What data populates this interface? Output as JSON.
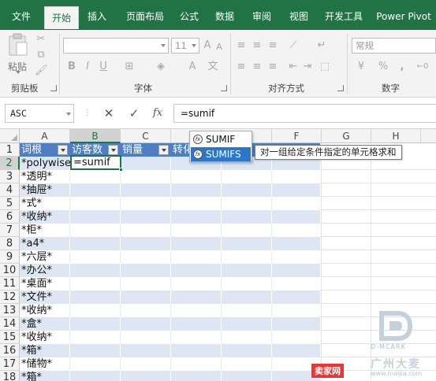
{
  "ribbon": {
    "tabs": [
      {
        "label": "文件",
        "active": false
      },
      {
        "label": "开始",
        "active": true
      },
      {
        "label": "插入",
        "active": false
      },
      {
        "label": "页面布局",
        "active": false
      },
      {
        "label": "公式",
        "active": false
      },
      {
        "label": "数据",
        "active": false
      },
      {
        "label": "审阅",
        "active": false
      },
      {
        "label": "视图",
        "active": false
      },
      {
        "label": "开发工具",
        "active": false
      },
      {
        "label": "Power Pivot",
        "active": false
      }
    ],
    "clipboard": {
      "paste_label": "粘贴",
      "group_label": "剪贴板"
    },
    "font": {
      "font_size": "11",
      "group_label": "字体"
    },
    "alignment": {
      "group_label": "对齐方式"
    },
    "number": {
      "format": "常规",
      "group_label": "数字"
    }
  },
  "formula_bar": {
    "name_box": "ASC",
    "cancel_icon": "✕",
    "enter_icon": "✓",
    "fx_icon": "fx",
    "formula": "=sumif"
  },
  "grid": {
    "columns": [
      "A",
      "B",
      "C",
      "D",
      "E",
      "F",
      "G",
      "H"
    ],
    "selected_column": "B",
    "header_cells": [
      "词根",
      "访客数",
      "销量",
      "转化"
    ],
    "row_numbers": [
      "1",
      "2",
      "3",
      "4",
      "5",
      "6",
      "7",
      "8",
      "9",
      "10",
      "11",
      "12",
      "13",
      "14",
      "15",
      "16",
      "17",
      "18"
    ],
    "active_cell_value": "=sumif",
    "column_a": [
      "*polywise*",
      "*透明*",
      "*抽屉*",
      "*式*",
      "*收纳*",
      "*柜*",
      "*a4*",
      "*六层*",
      "*办公*",
      "*桌面*",
      "*文件*",
      "*收纳*",
      "*盒*",
      "*收纳*",
      "*箱*",
      "*储物*",
      "*箱*"
    ]
  },
  "autocomplete": {
    "items": [
      {
        "label": "SUMIF",
        "selected": false
      },
      {
        "label": "SUMIFS",
        "selected": true
      }
    ],
    "tooltip": "对一组给定条件指定的单元格求和"
  },
  "watermark": {
    "brand": "D-MCARK",
    "cn": "广州大麦",
    "site": "卖家网",
    "url": "www.maijia.com"
  },
  "colors": {
    "excel_green": "#217346",
    "table_header": "#4d7fc2",
    "band_row": "#dde7f3",
    "autocomplete_selected": "#2a77c9"
  }
}
